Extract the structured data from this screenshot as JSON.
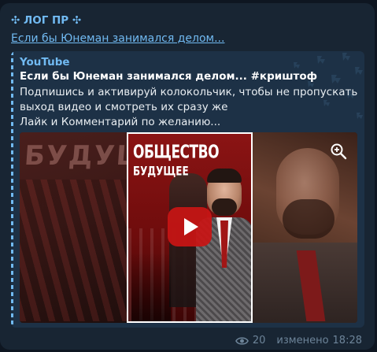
{
  "post": {
    "channel_name": "✣ ЛОГ ПР ✣",
    "headline_link": "Если бы Юнеман занимался делом..."
  },
  "preview": {
    "site_name": "YouTube",
    "title": "Если бы Юнеман занимался делом... #криштоф",
    "description_lines": [
      "Подпишись и активируй колокольчик, чтобы не пропускать",
      "выход видео и смотреть их сразу же",
      "Лайк и Комментарий по желанию..."
    ],
    "thumbnail_texts": {
      "title_line1": "ОБЩЕСТВО",
      "title_line2": "БУДУЩЕЕ",
      "blurred_bg_text": "БУДУЩЕ"
    }
  },
  "footer": {
    "views": "20",
    "status": "изменено",
    "time": "18:28"
  },
  "colors": {
    "background": "#0e1621",
    "bubble": "#182533",
    "link": "#71baf2",
    "preview_bg": "#1d3146",
    "meta": "#6d8499",
    "play_button": "#c81414"
  },
  "icons": {
    "zoom": "zoom-in-icon",
    "views": "eye-icon",
    "play": "play-icon"
  }
}
